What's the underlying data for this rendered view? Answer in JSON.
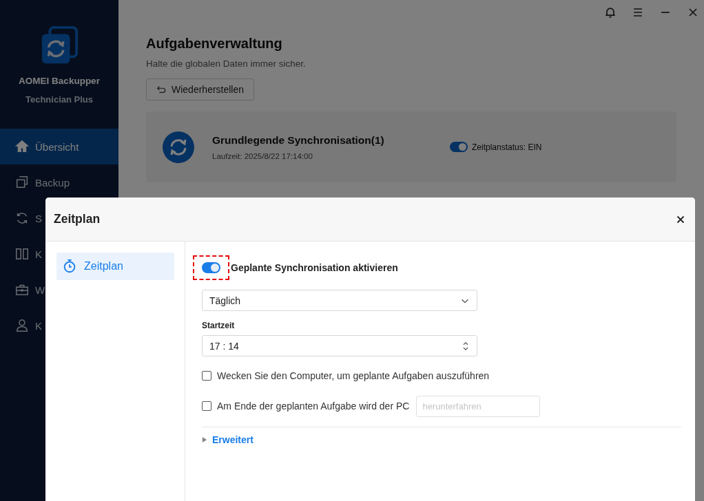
{
  "app": {
    "name": "AOMEI Backupper",
    "edition": "Technician Plus"
  },
  "sidebar": {
    "items": [
      {
        "label": "Übersicht",
        "selected": true
      },
      {
        "label": "Backup",
        "selected": false
      },
      {
        "label": "S",
        "selected": false
      },
      {
        "label": "K",
        "selected": false
      },
      {
        "label": "W",
        "selected": false
      },
      {
        "label": "K",
        "selected": false
      }
    ]
  },
  "main": {
    "title": "Aufgabenverwaltung",
    "subtitle": "Halte die globalen Daten immer sicher.",
    "restore_button": "Wiederherstellen",
    "task": {
      "name": "Grundlegende Synchronisation(1)",
      "runtime": "Laufzeit: 2025/8/22 17:14:00",
      "schedule_on": true,
      "schedule_status": "Zeitplanstatus: EIN"
    }
  },
  "dialog": {
    "title": "Zeitplan",
    "nav": [
      {
        "label": "Zeitplan",
        "selected": true
      }
    ],
    "enable": {
      "label": "Geplante Synchronisation aktivieren",
      "on": true,
      "highlighted": true
    },
    "frequency": {
      "value": "Täglich"
    },
    "start_time": {
      "label": "Startzeit",
      "value": "17 : 14"
    },
    "options": [
      {
        "label": "Wecken Sie den Computer, um geplante Aufgaben auszuführen",
        "checked": false
      },
      {
        "label": "Am Ende der geplanten Aufgabe wird der PC",
        "checked": false,
        "action_placeholder": "herunterfahren"
      }
    ],
    "advanced": {
      "label": "Erweitert",
      "expanded": false
    }
  }
}
